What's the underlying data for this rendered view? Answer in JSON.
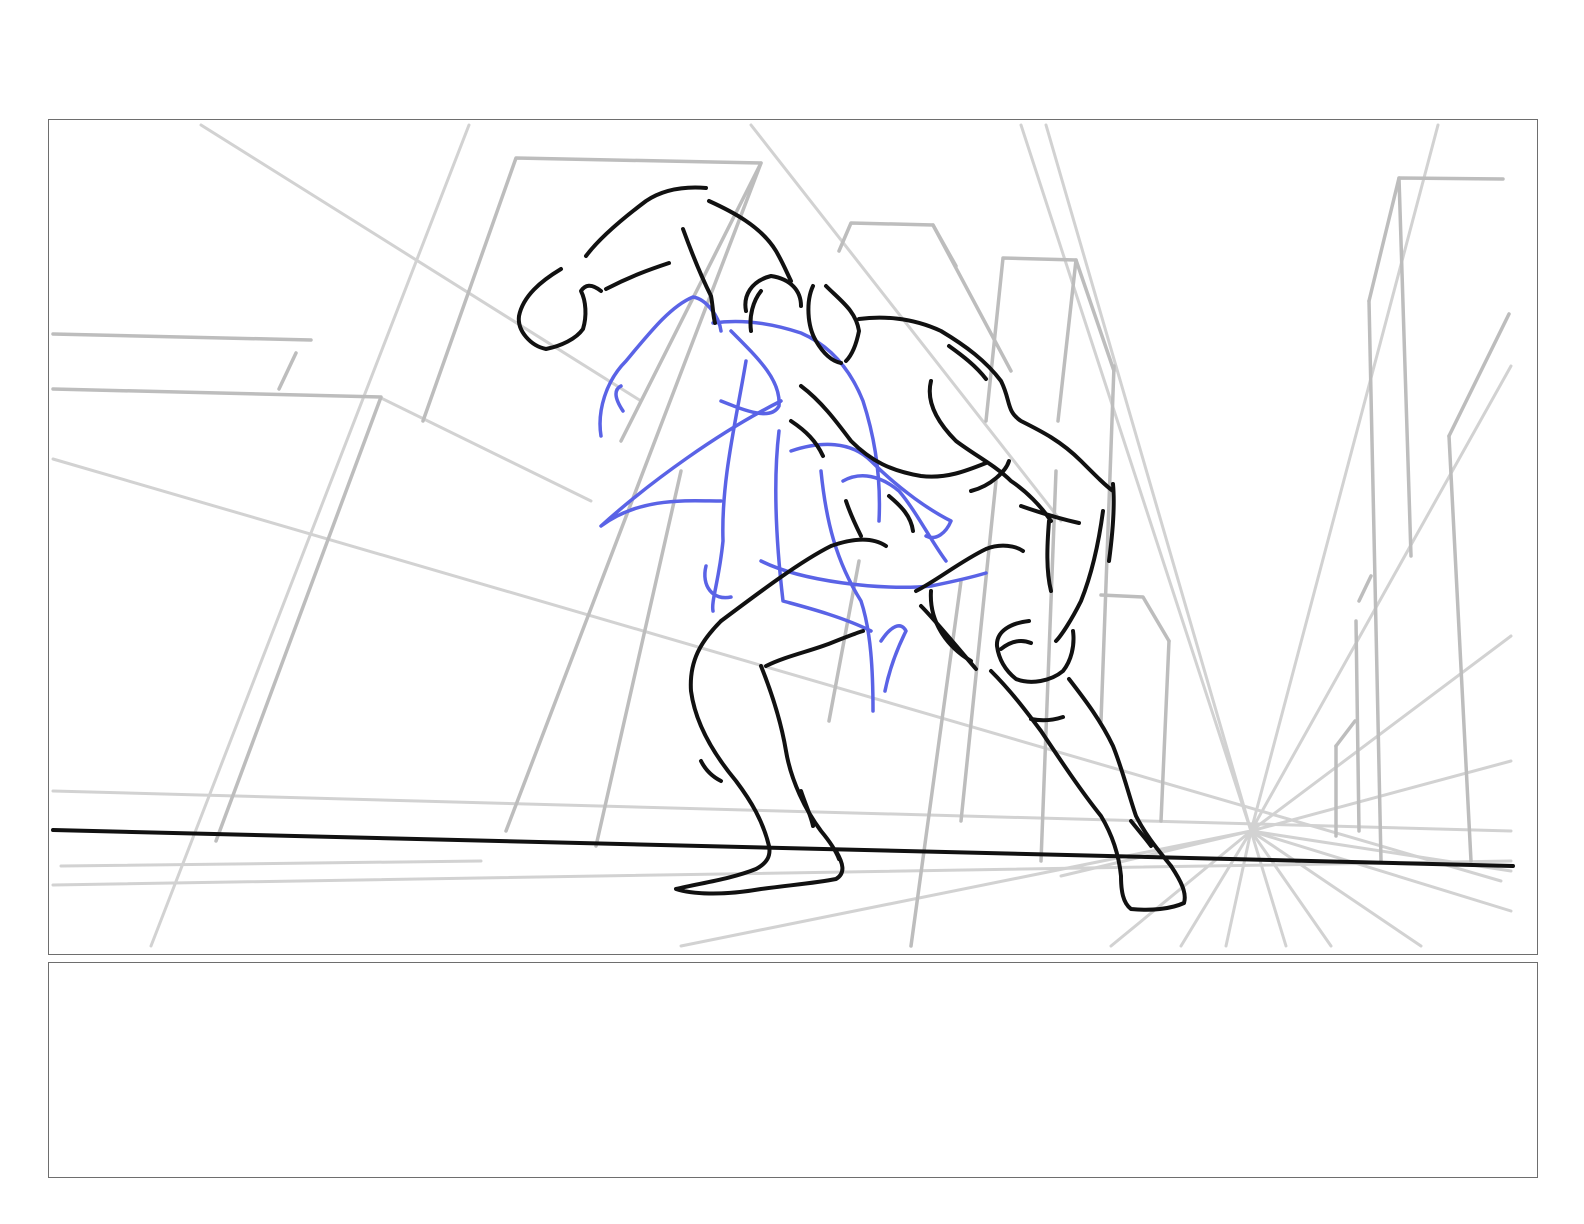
{
  "storyboard": {
    "drawing_panel": {
      "content": "sketch",
      "colors": {
        "perspective_lines": "#c9c9c9",
        "ground_line": "#111111",
        "final_figure": "#111111",
        "rough_figure": "#5a63e6",
        "panel_border": "#6e6e6e"
      }
    },
    "notes_panel": {
      "text": ""
    }
  }
}
